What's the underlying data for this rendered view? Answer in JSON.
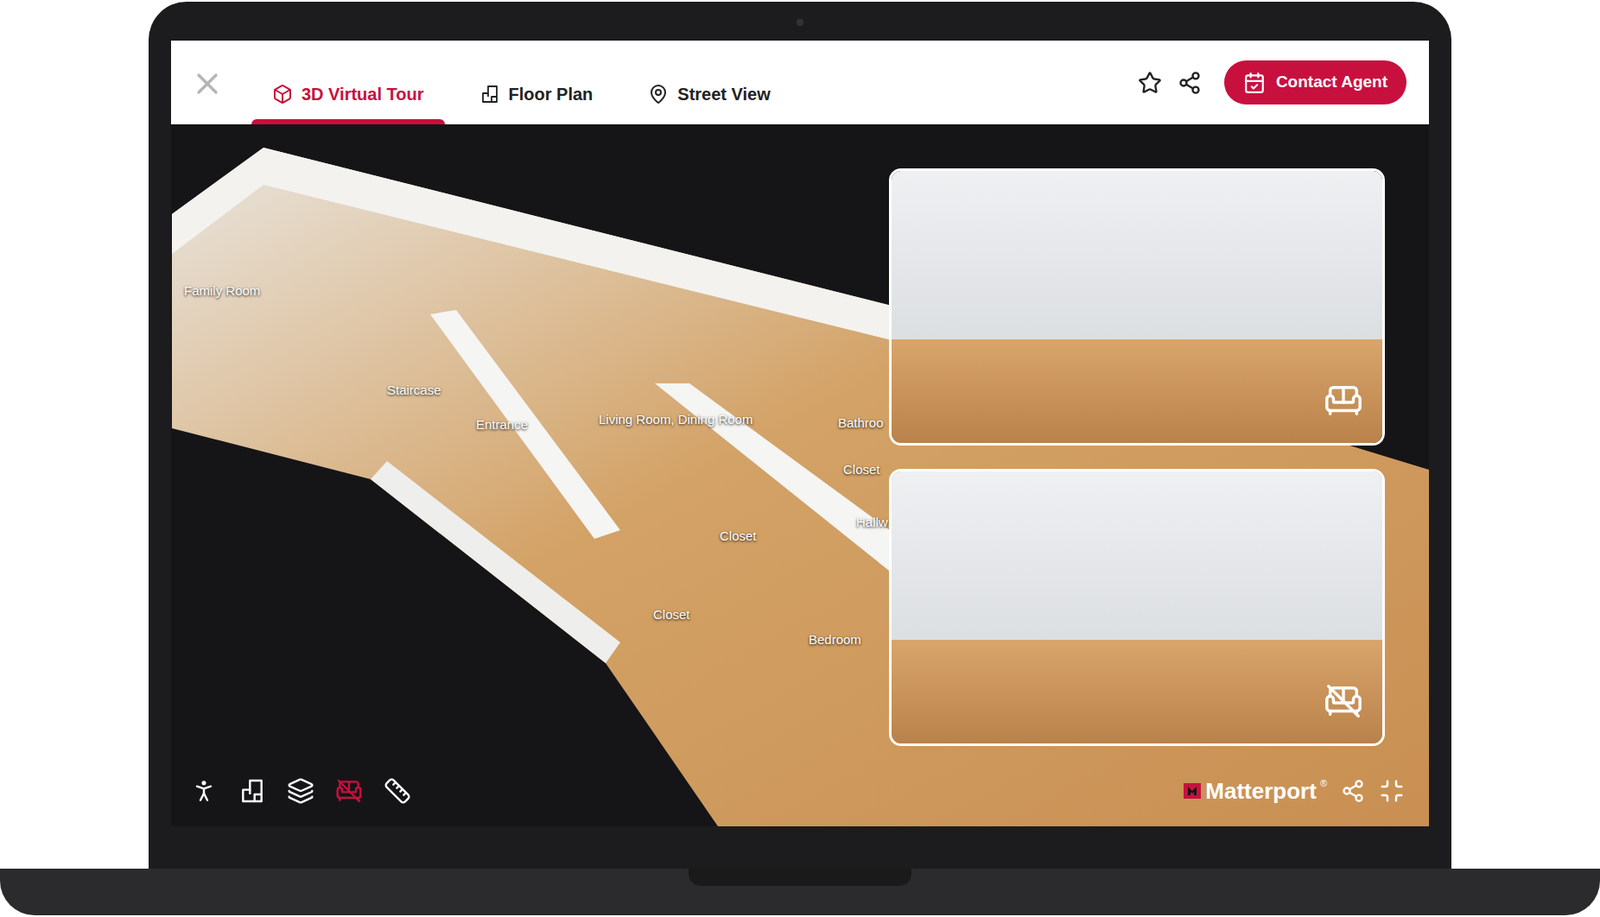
{
  "tabs": [
    {
      "label": "3D Virtual Tour",
      "selected": true
    },
    {
      "label": "Floor Plan",
      "selected": false
    },
    {
      "label": "Street View",
      "selected": false
    }
  ],
  "contact_button": "Contact Agent",
  "room_labels": [
    "Family Room",
    "Staircase",
    "Entrance",
    "Living Room, Dining Room",
    "Bathroo",
    "Closet",
    "Hallw",
    "Closet",
    "Closet",
    "Bedroom"
  ],
  "thumbnails": [
    {
      "kind": "furnished"
    },
    {
      "kind": "unfurnished"
    }
  ],
  "toolbar": {
    "tools": [
      {
        "kind": "walk",
        "selected": false
      },
      {
        "kind": "floorplan",
        "selected": false
      },
      {
        "kind": "layers",
        "selected": false
      },
      {
        "kind": "defurnish",
        "selected": true
      },
      {
        "kind": "measure",
        "selected": false
      }
    ]
  },
  "brand": {
    "name": "Matterport",
    "trademark": "®"
  }
}
